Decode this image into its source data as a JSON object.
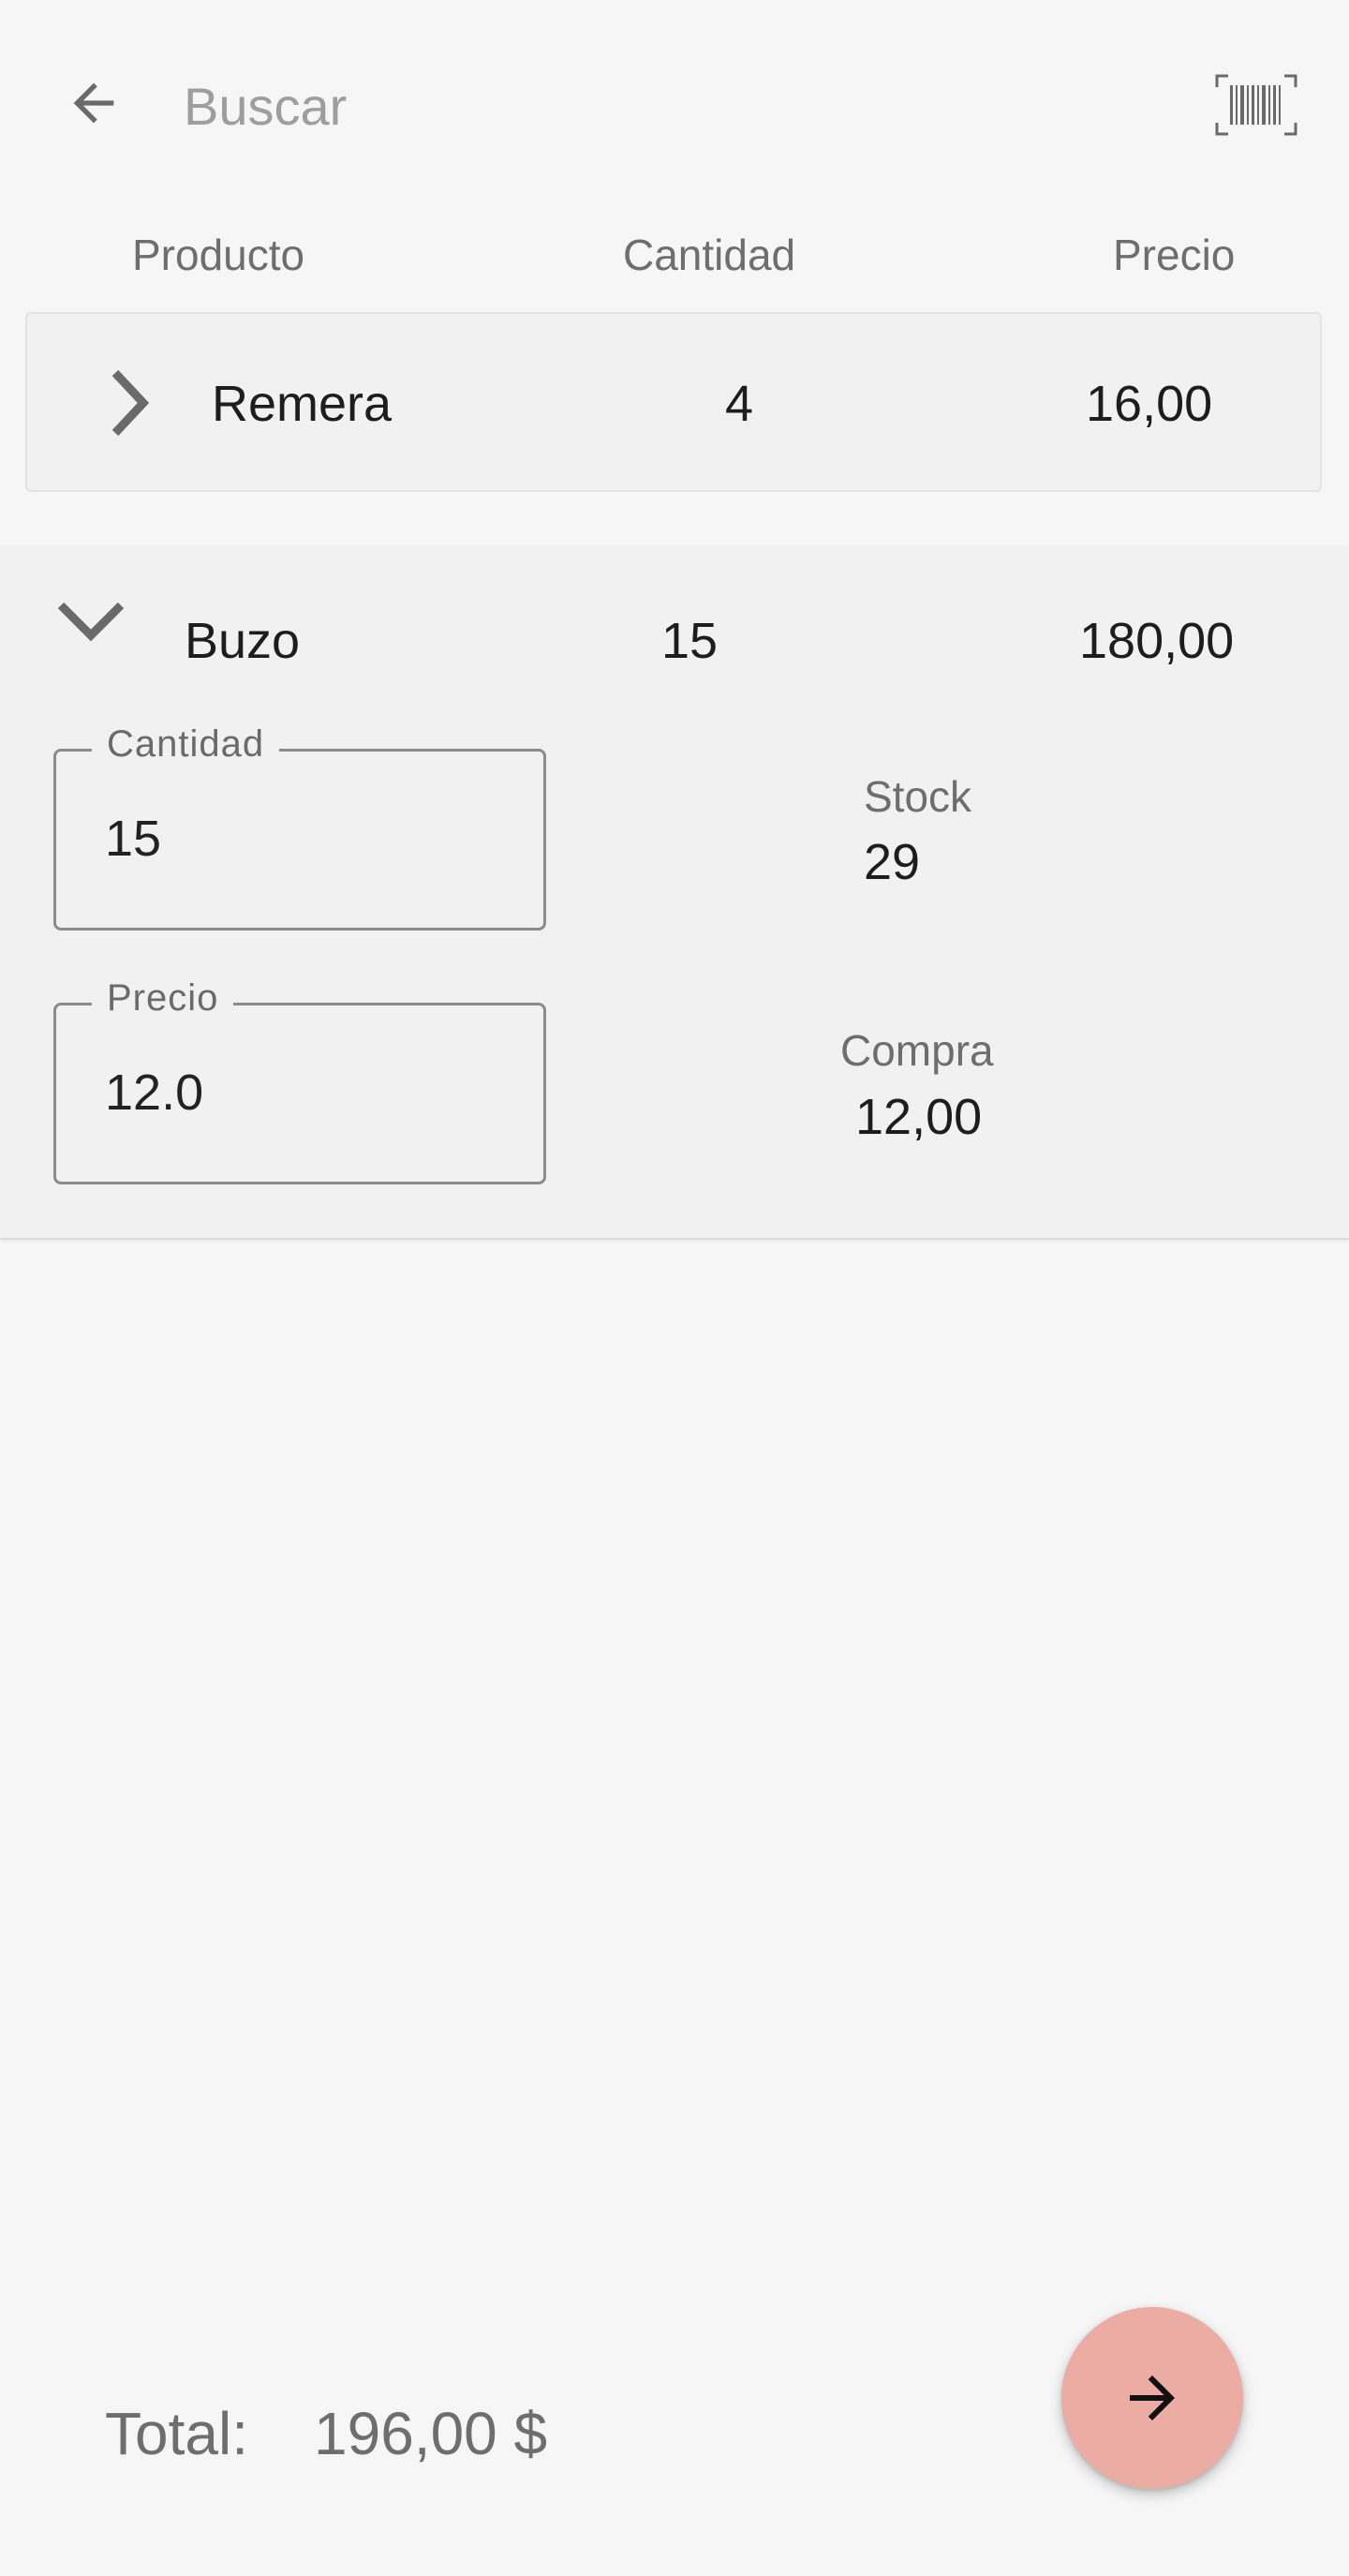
{
  "search": {
    "placeholder": "Buscar",
    "back_icon": "arrow-left-icon",
    "barcode_icon": "barcode-scan-icon"
  },
  "columns": {
    "product": "Producto",
    "quantity": "Cantidad",
    "price": "Precio"
  },
  "rows": [
    {
      "name": "Remera",
      "quantity": "4",
      "price": "16,00",
      "expanded": false,
      "toggle_icon": "chevron-right-icon"
    },
    {
      "name": "Buzo",
      "quantity": "15",
      "price": "180,00",
      "expanded": true,
      "toggle_icon": "chevron-down-icon",
      "details": {
        "quantity_field": {
          "label": "Cantidad",
          "value": "15"
        },
        "price_field": {
          "label": "Precio",
          "value": "12.0"
        },
        "stock": {
          "label": "Stock",
          "value": "29"
        },
        "purchase": {
          "label": "Compra",
          "value": "12,00"
        }
      }
    }
  ],
  "footer": {
    "total_label": "Total:",
    "total_value": "196,00 $",
    "next_icon": "arrow-right-icon"
  },
  "colors": {
    "background": "#f6f6f7",
    "card": "#f1f1f2",
    "fab": "#ebaca3",
    "muted_text": "#6e6e6e",
    "primary_text": "#1d1d1d"
  }
}
